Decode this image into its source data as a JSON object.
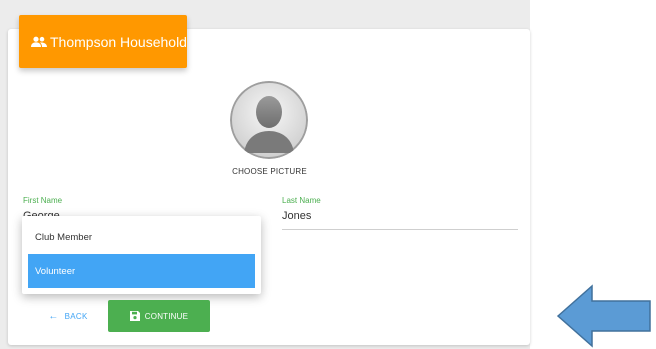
{
  "header": {
    "title": "Thompson Household",
    "icon": "people-icon",
    "color": "#ff9800"
  },
  "profile": {
    "avatar_icon": "avatar-placeholder-icon",
    "choose_picture_label": "CHOOSE PICTURE"
  },
  "form": {
    "first_name": {
      "label": "First Name",
      "value": "George"
    },
    "last_name": {
      "label": "Last Name",
      "value": "Jones"
    },
    "role_dropdown": {
      "options": [
        "Club Member",
        "Volunteer"
      ],
      "selected": "Volunteer"
    }
  },
  "actions": {
    "back_label": "BACK",
    "back_icon": "arrow-left-icon",
    "continue_label": "CONTINUE",
    "continue_icon": "floppy-disk-icon"
  },
  "annotation": {
    "icon": "left-arrow-annotation",
    "color": "#5b9bd5"
  },
  "colors": {
    "accent_green": "#4caf50",
    "accent_blue": "#42a5f5",
    "header_orange": "#ff9800"
  }
}
